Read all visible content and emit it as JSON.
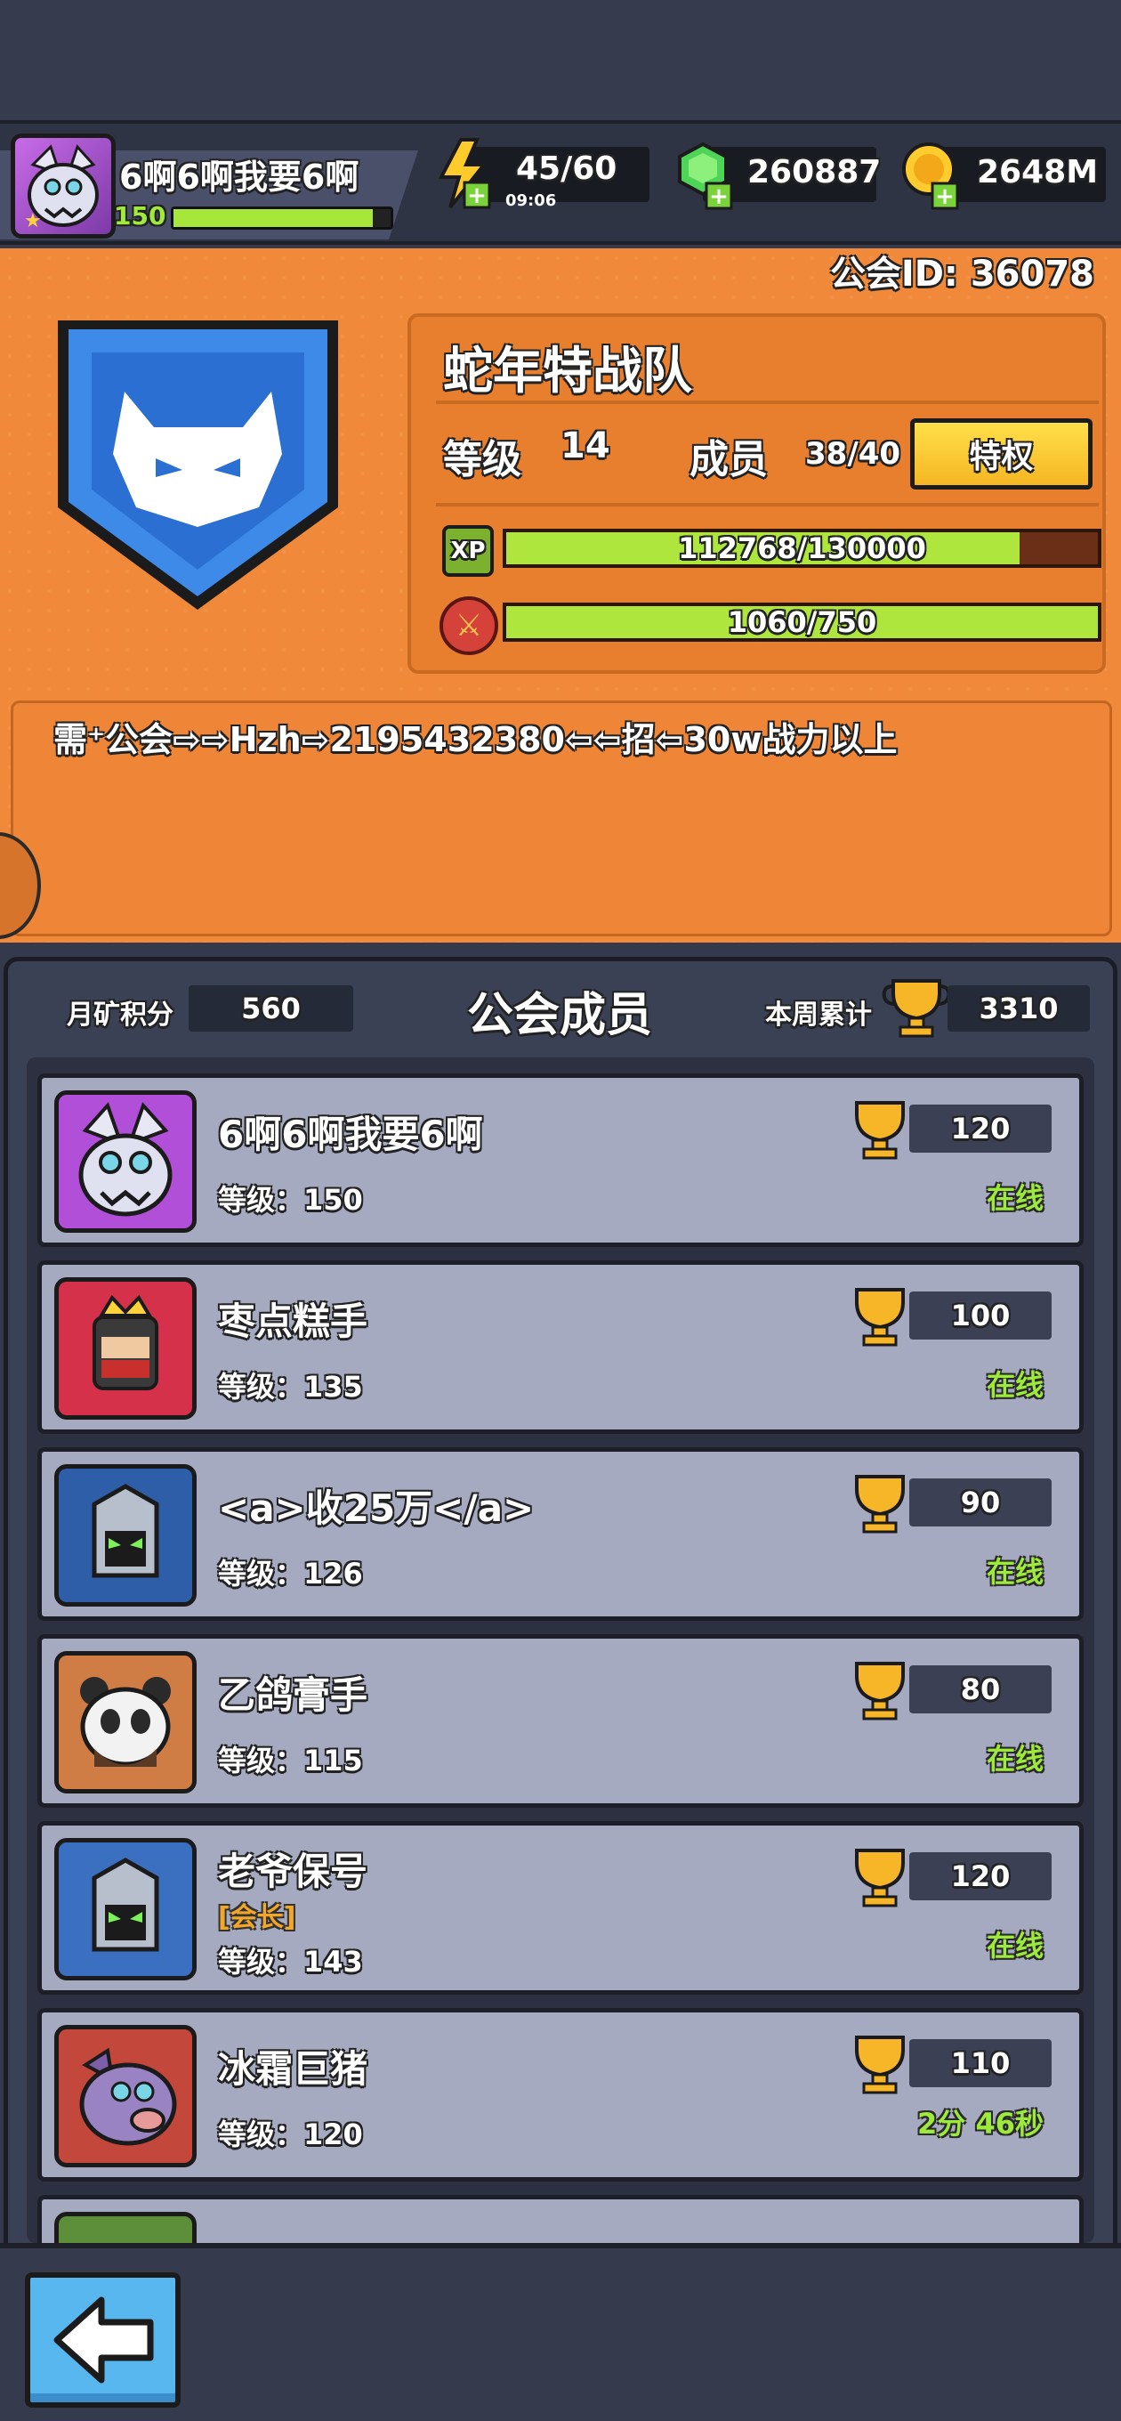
{
  "player": {
    "name": "6啊6啊我要6啊",
    "level": "150",
    "xp_fraction": 0.92
  },
  "resources": {
    "energy": "45/60",
    "energy_timer": "09:06",
    "gems": "260887",
    "gold": "2648M"
  },
  "guild": {
    "id_label": "公会ID: 36078",
    "name": "蛇年特战队",
    "level_label": "等级",
    "level": "14",
    "members_label": "成员",
    "members": "38/40",
    "perks_button": "特权",
    "xp_icon": "XP",
    "xp_text": "112768/130000",
    "xp_fraction": 0.8674,
    "war_text": "1060/750",
    "war_fraction": 1.0,
    "notice": "需⁺公会⇨⇨Hzh⇨2195432380⇦⇦招⇦30w战力以上"
  },
  "members_panel": {
    "title": "公会成员",
    "mine_label": "月矿积分",
    "mine_value": "560",
    "weekly_label": "本周累计",
    "weekly_value": "3310"
  },
  "members": [
    {
      "name": "6啊6啊我要6啊",
      "level": "等级：150",
      "trophies": "120",
      "status": "在线",
      "role": "",
      "avatar": "wolf-avatar-icon",
      "color": "#b24fd8"
    },
    {
      "name": "枣点糕手",
      "level": "等级：135",
      "trophies": "100",
      "status": "在线",
      "role": "",
      "avatar": "king-avatar-icon",
      "color": "#d6314b"
    },
    {
      "name": "<a>收25万</a>",
      "level": "等级：126",
      "trophies": "90",
      "status": "在线",
      "role": "",
      "avatar": "knight-avatar-icon",
      "color": "#2f5ea8"
    },
    {
      "name": "乙鸽膏手",
      "level": "等级：115",
      "trophies": "80",
      "status": "在线",
      "role": "",
      "avatar": "panda-avatar-icon",
      "color": "#cf7d45"
    },
    {
      "name": "老爷保号",
      "level": "等级：143",
      "trophies": "120",
      "status": "在线",
      "role": "[会长]",
      "avatar": "knight-avatar-icon",
      "color": "#3b6fbf"
    },
    {
      "name": "冰霜巨猪",
      "level": "等级：120",
      "trophies": "110",
      "status": "2分 46秒",
      "role": "",
      "avatar": "boar-avatar-icon",
      "color": "#c3473b"
    }
  ],
  "colors": {
    "accent_orange": "#f08a3a",
    "online_green": "#9eea3c",
    "bar_green": "#aee63e"
  }
}
